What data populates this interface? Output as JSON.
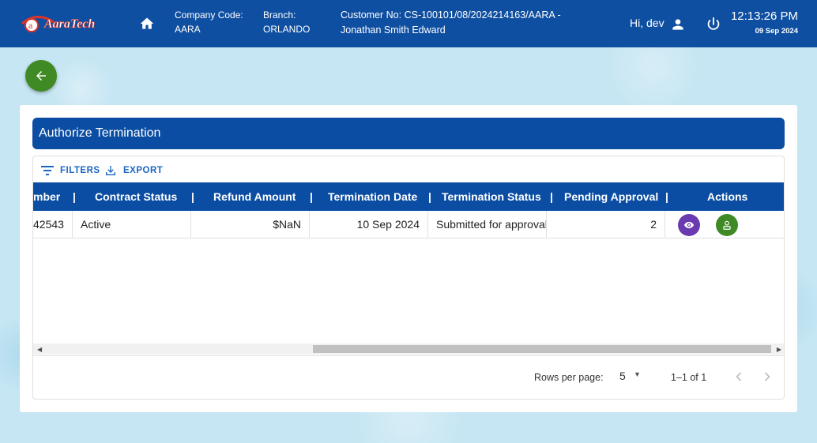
{
  "header": {
    "logo_text": "AaraTech",
    "company_code_label": "Company Code:",
    "company_code_value": "AARA",
    "branch_label": "Branch:",
    "branch_value": "ORLANDO",
    "customer_line1": "Customer No: CS-100101/08/2024214163/AARA -",
    "customer_line2": "Jonathan Smith Edward",
    "greeting": "Hi, dev",
    "time": "12:13:26 PM",
    "date": "09 Sep 2024",
    "icons": [
      "home-icon",
      "user-icon",
      "power-icon"
    ]
  },
  "page": {
    "title": "Authorize Termination"
  },
  "toolbar": {
    "filters_label": "FILTERS",
    "export_label": "EXPORT"
  },
  "table": {
    "columns": [
      "mber",
      "Contract Status",
      "Refund Amount",
      "Termination Date",
      "Termination Status",
      "Pending Approval",
      "Actions"
    ],
    "rows": [
      {
        "number": "42543",
        "contract_status": "Active",
        "refund_amount": "$NaN",
        "termination_date": "10 Sep 2024",
        "termination_status": "Submitted for approval",
        "pending_approval": "2"
      }
    ]
  },
  "pagination": {
    "rows_per_page_label": "Rows per page:",
    "rows_per_page_value": "5",
    "range": "1–1 of 1"
  },
  "colors": {
    "header_blue": "#0f4fa1",
    "table_header_blue": "#0a4da3",
    "green": "#3f8a25",
    "purple": "#6a3ab0"
  }
}
